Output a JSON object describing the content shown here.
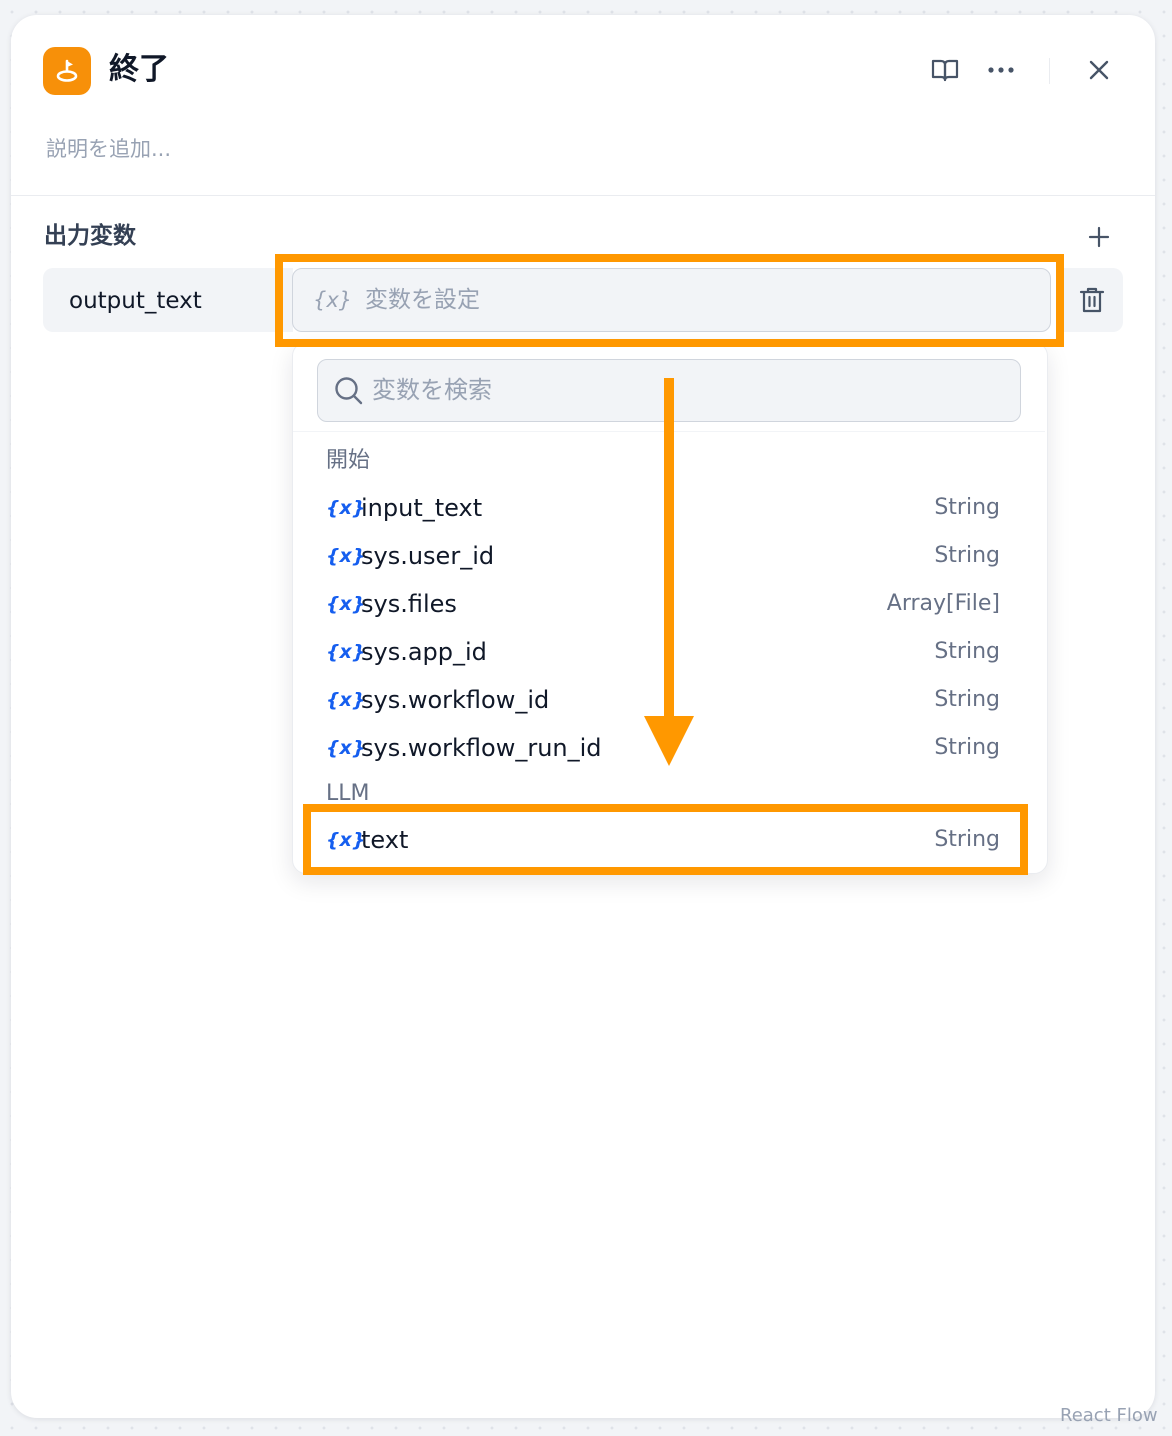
{
  "header": {
    "title": "終了",
    "description_placeholder": "説明を追加..."
  },
  "output_section": {
    "title": "出力変数",
    "variable_name": "output_text",
    "variable_placeholder": "変数を設定",
    "var_icon": "{x}"
  },
  "dropdown": {
    "search_placeholder": "変数を検索",
    "groups": [
      {
        "label": "開始",
        "items": [
          {
            "icon": "{x}",
            "name": "input_text",
            "type": "String"
          },
          {
            "icon": "{x}",
            "name": "sys.user_id",
            "type": "String"
          },
          {
            "icon": "{x}",
            "name": "sys.files",
            "type": "Array[File]"
          },
          {
            "icon": "{x}",
            "name": "sys.app_id",
            "type": "String"
          },
          {
            "icon": "{x}",
            "name": "sys.workflow_id",
            "type": "String"
          },
          {
            "icon": "{x}",
            "name": "sys.workflow_run_id",
            "type": "String"
          }
        ]
      },
      {
        "label": "LLM",
        "items": [
          {
            "icon": "{x}",
            "name": "text",
            "type": "String"
          }
        ]
      }
    ]
  },
  "watermark": "React Flow",
  "colors": {
    "accent": "#f79009",
    "annotation": "#ff9800",
    "variable_icon": "#155eef"
  },
  "icons": [
    "end-node-icon",
    "book-icon",
    "more-icon",
    "close-icon",
    "plus-icon",
    "trash-icon",
    "search-icon",
    "variable-icon",
    "arrow-down-annotation"
  ]
}
